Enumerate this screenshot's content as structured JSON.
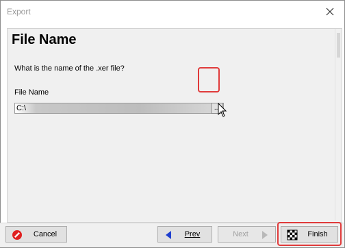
{
  "window": {
    "title": "Export"
  },
  "page": {
    "heading": "File Name",
    "question": "What is the name of the .xer file?",
    "field_label": "File Name",
    "path_value": "C:\\",
    "browse_label": "..."
  },
  "buttons": {
    "cancel": "Cancel",
    "prev": "Prev",
    "next": "Next",
    "finish": "Finish"
  },
  "colors": {
    "highlight": "#e03a3a",
    "arrow_blue": "#1f3fcf"
  },
  "icons": {
    "close": "close-icon",
    "cancel": "no-entry-icon",
    "prev": "left-arrow-icon",
    "next": "right-arrow-icon",
    "finish": "checkered-flag-icon",
    "pointer": "mouse-pointer-icon"
  }
}
